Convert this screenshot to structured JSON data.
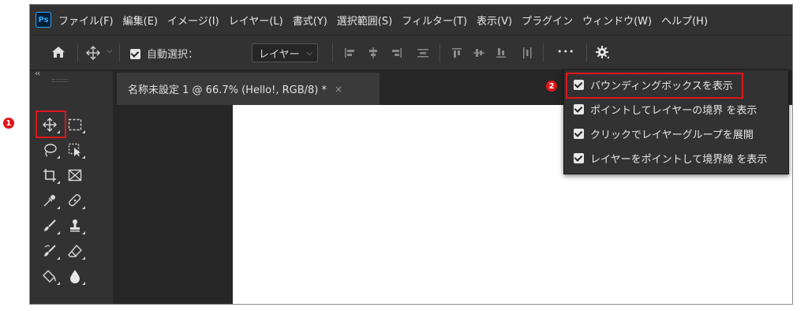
{
  "menubar": {
    "logo": "Ps",
    "items": [
      "ファイル(F)",
      "編集(E)",
      "イメージ(I)",
      "レイヤー(L)",
      "書式(Y)",
      "選択範囲(S)",
      "フィルター(T)",
      "表示(V)",
      "プラグイン",
      "ウィンドウ(W)",
      "ヘルプ(H)"
    ]
  },
  "options": {
    "auto_select_label": "自動選択：",
    "auto_select_checked": true,
    "select_value": "レイヤー",
    "more": "•••"
  },
  "document": {
    "tab_title": "名称未設定 1 @ 66.7% (Hello!, RGB/8) *",
    "close": "×"
  },
  "dropdown": {
    "items": [
      {
        "label": "バウンディングボックスを表示",
        "checked": true
      },
      {
        "label": "ポイントしてレイヤーの境界 を表示",
        "checked": true
      },
      {
        "label": "クリックでレイヤーグループを展開",
        "checked": true
      },
      {
        "label": "レイヤーをポイントして境界線 を表示",
        "checked": true
      }
    ]
  },
  "annotations": {
    "badge1": "1",
    "badge2": "2",
    "badge_color": "#e0141a",
    "highlight_color": "#e0141a"
  },
  "panel": {
    "collapse": "‹‹"
  }
}
